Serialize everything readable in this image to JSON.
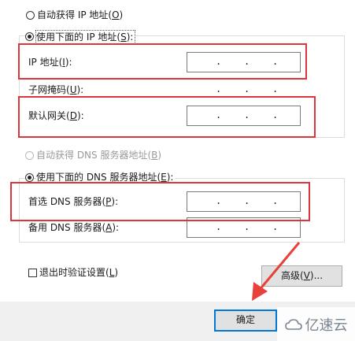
{
  "auto_ip": {
    "label": "自动获得 IP 地址(",
    "hotkey": "O",
    "suffix": ")"
  },
  "manual_ip": {
    "label": "使用下面的 IP 地址(",
    "hotkey": "S",
    "suffix": "):"
  },
  "ip_address": {
    "label": "IP 地址(",
    "hotkey": "I",
    "suffix": "):"
  },
  "subnet_mask": {
    "label": "子网掩码(",
    "hotkey": "U",
    "suffix": "):"
  },
  "default_gateway": {
    "label": "默认网关(",
    "hotkey": "D",
    "suffix": "):"
  },
  "auto_dns": {
    "label": "自动获得 DNS 服务器地址(",
    "hotkey": "B",
    "suffix": ")"
  },
  "manual_dns": {
    "label": "使用下面的 DNS 服务器地址(",
    "hotkey": "E",
    "suffix": "):"
  },
  "preferred_dns": {
    "label": "首选 DNS 服务器(",
    "hotkey": "P",
    "suffix": "):"
  },
  "alternate_dns": {
    "label": "备用 DNS 服务器(",
    "hotkey": "A",
    "suffix": "):"
  },
  "validate_on_exit": {
    "label": "退出时验证设置(",
    "hotkey": "L",
    "suffix": ")"
  },
  "advanced_button": {
    "label": "高级(",
    "hotkey": "V",
    "suffix": ")..."
  },
  "ok_button": {
    "label": "确定"
  },
  "ip_separator": ".",
  "watermark": {
    "text": "亿速云"
  },
  "colors": {
    "highlight": "#d9363e",
    "focus": "#0078d7",
    "arrow": "#e8413b"
  }
}
